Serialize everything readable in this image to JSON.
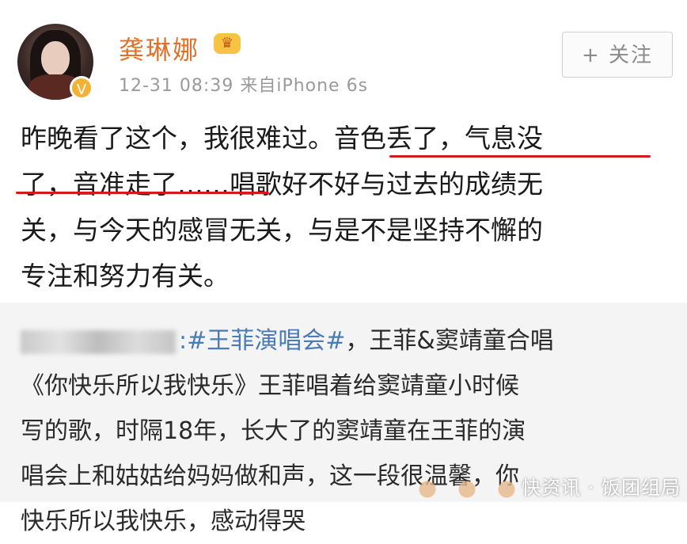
{
  "header": {
    "username": "龚琳娜",
    "vip_icon": "crown-vip-icon",
    "verified_icon": "verified-v-icon",
    "verified_glyph": "V",
    "timestamp": "12-31 08:39",
    "source": "来自iPhone 6s",
    "follow_label": "+ 关注"
  },
  "post": {
    "lines": [
      "昨晚看了这个，我很难过。音色丢了，气息没",
      "了，音准走了……唱歌好不好与过去的成绩无",
      "关，与今天的感冒无关，与是不是坚持不懈的",
      "专注和努力有关。"
    ],
    "underline_color": "#d41a1a"
  },
  "repost": {
    "line1_hashtag": ":#王菲演唱会#",
    "line1_rest": "，王菲&窦靖童合唱",
    "lines": [
      "《你快乐所以我快乐》王菲唱着给窦靖童小时候",
      "写的歌，时隔18年，长大了的窦靖童在王菲的演",
      "唱会上和姑姑给妈妈做和声，这一段很温馨，你",
      "快乐所以我快乐，感动得哭"
    ]
  },
  "watermark": "快资讯 · 饭团组局",
  "colors": {
    "username": "#e0712a",
    "link": "#4a7bb7",
    "repost_bg": "#f4f4f4"
  }
}
